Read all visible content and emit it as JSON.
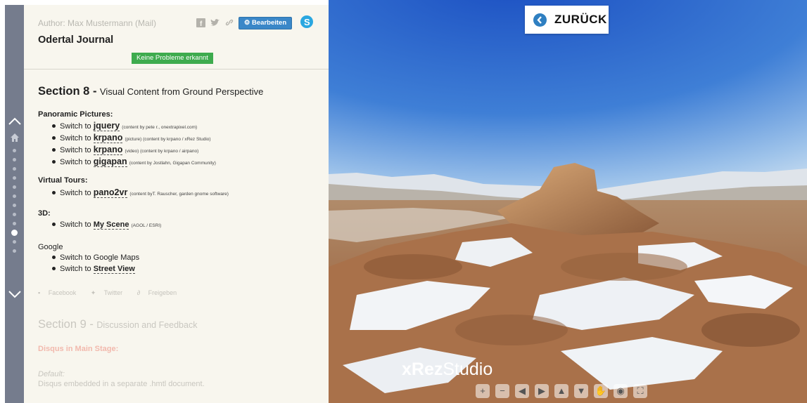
{
  "header": {
    "author": "Author: Max Mustermann (Mail)",
    "edit_label": "Bearbeiten",
    "title": "Odertal Journal",
    "status": "Keine Probleme erkannt"
  },
  "section8": {
    "number": "Section 8 -",
    "subtitle": "Visual Content from Ground Perspective",
    "groups": {
      "panoramic": "Panoramic Pictures:",
      "tours": "Virtual Tours:",
      "threed": "3D:",
      "google": "Google"
    },
    "items": [
      {
        "prefix": "Switch to",
        "keyword": "jquery",
        "note": "(content by pete r., onextrapixel.com)"
      },
      {
        "prefix": "Switch to",
        "keyword": "krpano",
        "note": "(picture) (content by krpano / xRez Studio)"
      },
      {
        "prefix": "Switch to",
        "keyword": "krpano",
        "note": "(video) (content by krpano / airpano)"
      },
      {
        "prefix": "Switch to",
        "keyword": "gigapan",
        "note": "(content by Jostlahn, Gigapan Community)"
      },
      {
        "prefix": "Switch to",
        "keyword": "pano2vr",
        "note": "(content byT. Rauscher, garden gnome software)"
      },
      {
        "prefix": "Switch to",
        "keyword": "My Scene",
        "note": "(AGOL / ESRI)"
      },
      {
        "prefix": "Switch to Google Maps",
        "keyword": "",
        "note": ""
      },
      {
        "prefix": "Switch to",
        "keyword": "Street View",
        "note": ""
      }
    ]
  },
  "socials": {
    "facebook": "Facebook",
    "twitter": "Twitter",
    "share": "Freigeben"
  },
  "section9": {
    "number": "Section 9 -",
    "subtitle": "Discussion and Feedback",
    "disqus": "Disqus in Main Stage:",
    "default_label": "Default:",
    "default_desc": "Disqus embedded in a separate .hmtl document."
  },
  "pano": {
    "back_label": "ZURÜCK",
    "watermark_bold": "xRez",
    "watermark_light": "Studio"
  },
  "nav": {
    "active_index": 9,
    "dot_count": 12
  },
  "colors": {
    "rail": "#757c8d",
    "panel": "#f8f6ee",
    "accent_blue": "#3a87c8",
    "ok_green": "#3eab4e"
  },
  "icons": [
    "home-icon",
    "chevron-up-icon",
    "chevron-down-icon",
    "facebook-icon",
    "twitter-icon",
    "link-icon",
    "gear-icon",
    "skype-icon",
    "back-chevron-icon",
    "zoom-in-icon",
    "zoom-out-icon",
    "pan-left-icon",
    "pan-right-icon",
    "pan-up-icon",
    "pan-down-icon",
    "hand-icon",
    "globe-icon",
    "fullscreen-icon"
  ]
}
